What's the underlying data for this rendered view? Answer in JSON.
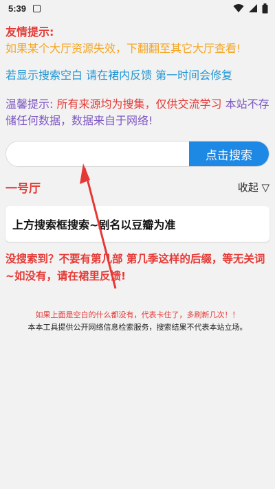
{
  "status_bar": {
    "time": "5:39",
    "icons": [
      "sim-card-icon",
      "wifi-icon",
      "signal-icon",
      "battery-icon"
    ]
  },
  "tips": {
    "title": "友情提示:",
    "line1": "如果某个大厅资源失效，下翻翻至其它大厅查看!",
    "line2": "若显示搜索空白 请在裙内反馈 第一时间会修复",
    "warm_label": "温馨提示:",
    "warm_text1": "所有来源均为搜集，仅供交流学习",
    "warm_text2": "本站不存储任何数据，数据来自于网络!"
  },
  "search": {
    "value": "",
    "placeholder": "",
    "button_label": "点击搜索"
  },
  "hall": {
    "title": "一号厅",
    "collapse_label": "收起 ▽"
  },
  "result_card": {
    "text": "上方搜索框搜索~剧名以豆瓣为准"
  },
  "notice": {
    "text": "没搜索到？不要有第几部 第几季这样的后缀，等无关词~如没有，请在裙里反馈!"
  },
  "footer": {
    "line1": "如果上面是空白的什么都没有，代表卡住了，多刷新几次！！",
    "line2": "本本工具提供公开网络信息检索服务，搜索结果不代表本站立场。"
  },
  "colors": {
    "red": "#e53935",
    "orange": "#f5a623",
    "blue": "#2196d3",
    "purple": "#7e57c2",
    "button_blue": "#1e88e5"
  }
}
